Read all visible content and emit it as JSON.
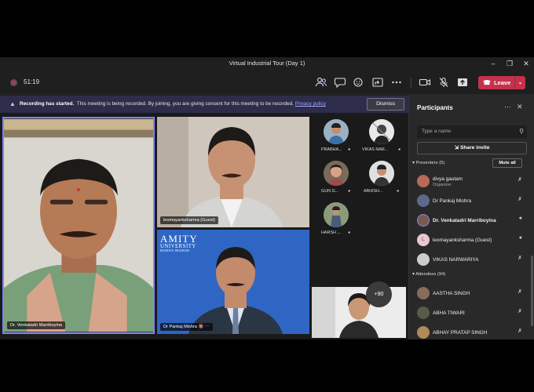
{
  "window": {
    "title": "Virtual Industrial Tour (Day 1)"
  },
  "toolbar": {
    "timer": "51:19",
    "leave_label": "Leave"
  },
  "banner": {
    "bold_text": "Recording has started.",
    "text": "This meeting is being recorded. By joining, you are giving consent for this meeting to be recorded.",
    "link": "Privacy policy",
    "dismiss_label": "Dismiss"
  },
  "videos": {
    "main": {
      "name": "Dr. Venkatadri Marriboyina"
    },
    "top_right": {
      "name": "leomayanksharma (Guest)"
    },
    "bottom_middle": {
      "name": "Dr Pankaj Mishra",
      "logo_line1": "AMITY",
      "logo_line2": "UNIVERSITY",
      "logo_line3": "MADHYA PRADESH"
    }
  },
  "avatars": [
    {
      "label": "PRABHA..."
    },
    {
      "label": "VIKAS NAR..."
    },
    {
      "label": "GUN G..."
    },
    {
      "label": "ABHISH..."
    },
    {
      "label": "HARSH ..."
    }
  ],
  "more_count": "+90",
  "participants": {
    "title": "Participants",
    "search_placeholder": "Type a name",
    "share_invite": "Share invite",
    "presenters_header": "Presenters (5)",
    "mute_all": "Mute all",
    "presenters": [
      {
        "name": "divya gautam",
        "role": "Organizer"
      },
      {
        "name": "Dr Pankaj Mishra",
        "role": ""
      },
      {
        "name": "Dr. Venkatadri Marriboyina",
        "role": ""
      },
      {
        "name": "leomayanksharma (Guest)",
        "role": ""
      },
      {
        "name": "VIKAS NARWARIYA",
        "role": ""
      }
    ],
    "attendees_header": "Attendees (94)",
    "attendees": [
      {
        "name": "AASTHA SINGH"
      },
      {
        "name": "ABHA TIWARI"
      },
      {
        "name": "ABHAY PRATAP SINGH"
      }
    ]
  },
  "colors": {
    "leave": "#c4314b",
    "banner": "#2d2c4a",
    "panel": "#292929",
    "link": "#9fa7ff"
  },
  "icons": [
    "people-icon",
    "chat-icon",
    "reactions-icon",
    "share-icon",
    "more-icon",
    "camera-icon",
    "mic-off-icon",
    "share-tray-icon",
    "phone-icon"
  ]
}
